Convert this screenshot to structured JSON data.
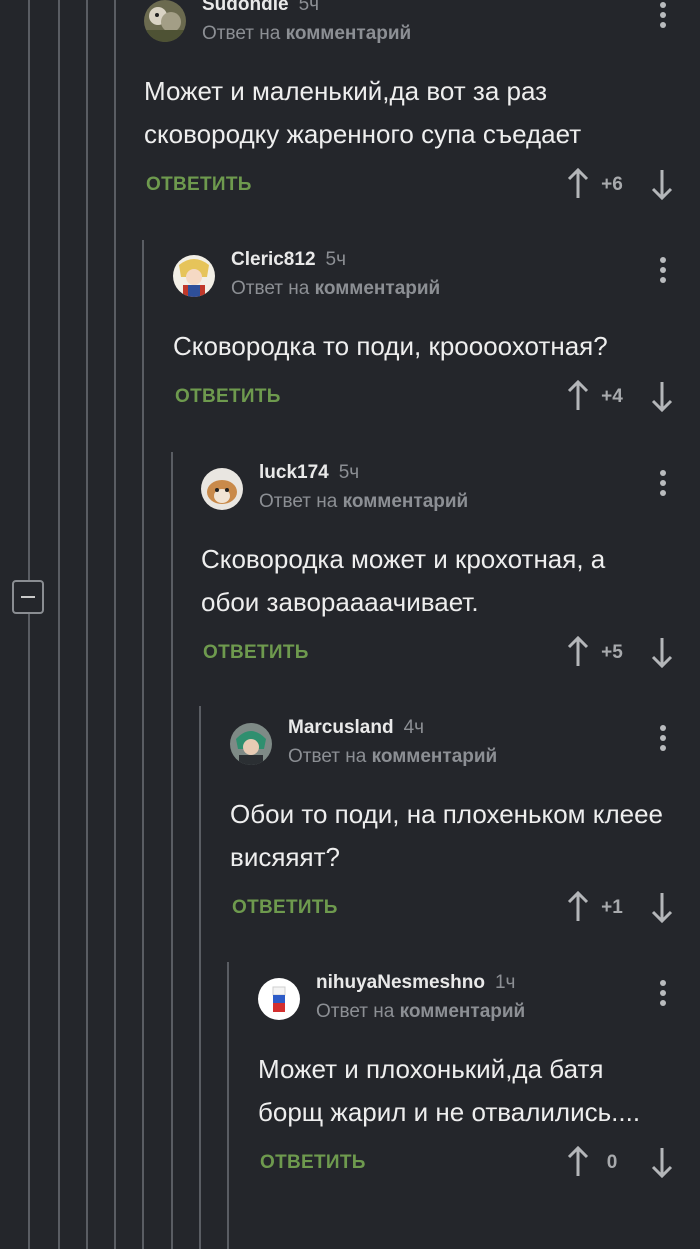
{
  "comments": [
    {
      "author": "Sudondie",
      "time": "5ч",
      "reply_prefix": "Ответ на",
      "reply_target": "комментарий",
      "text": "Может и маленький,да вот за раз сковородку жаренного супа съедает",
      "reply_label": "ОТВЕТИТЬ",
      "score": "+6"
    },
    {
      "author": "Cleric812",
      "time": "5ч",
      "reply_prefix": "Ответ на",
      "reply_target": "комментарий",
      "text": "Сковородка то поди, кроооохотная?",
      "reply_label": "ОТВЕТИТЬ",
      "score": "+4"
    },
    {
      "author": "luck174",
      "time": "5ч",
      "reply_prefix": "Ответ на",
      "reply_target": "комментарий",
      "text": "Сковородка может и крохотная, а обои завораааачивает.",
      "reply_label": "ОТВЕТИТЬ",
      "score": "+5"
    },
    {
      "author": "Marcusland",
      "time": "4ч",
      "reply_prefix": "Ответ на",
      "reply_target": "комментарий",
      "text": "Обои то поди, на плохеньком клеее висяяят?",
      "reply_label": "ОТВЕТИТЬ",
      "score": "+1"
    },
    {
      "author": "nihuyaNesmeshno",
      "time": "1ч",
      "reply_prefix": "Ответ на",
      "reply_target": "комментарий",
      "text": "Может и плохонький,да батя борщ жарил и не отвалились....",
      "reply_label": "ОТВЕТИТЬ",
      "score": "0"
    }
  ],
  "colors": {
    "background": "#24262b",
    "reply_green": "#6e9a4e",
    "thread_line": "#5a5d63"
  },
  "icons": {
    "collapse": "minus-square-icon",
    "upvote": "arrow-up-icon",
    "downvote": "arrow-down-icon",
    "menu": "more-vertical-icon"
  }
}
